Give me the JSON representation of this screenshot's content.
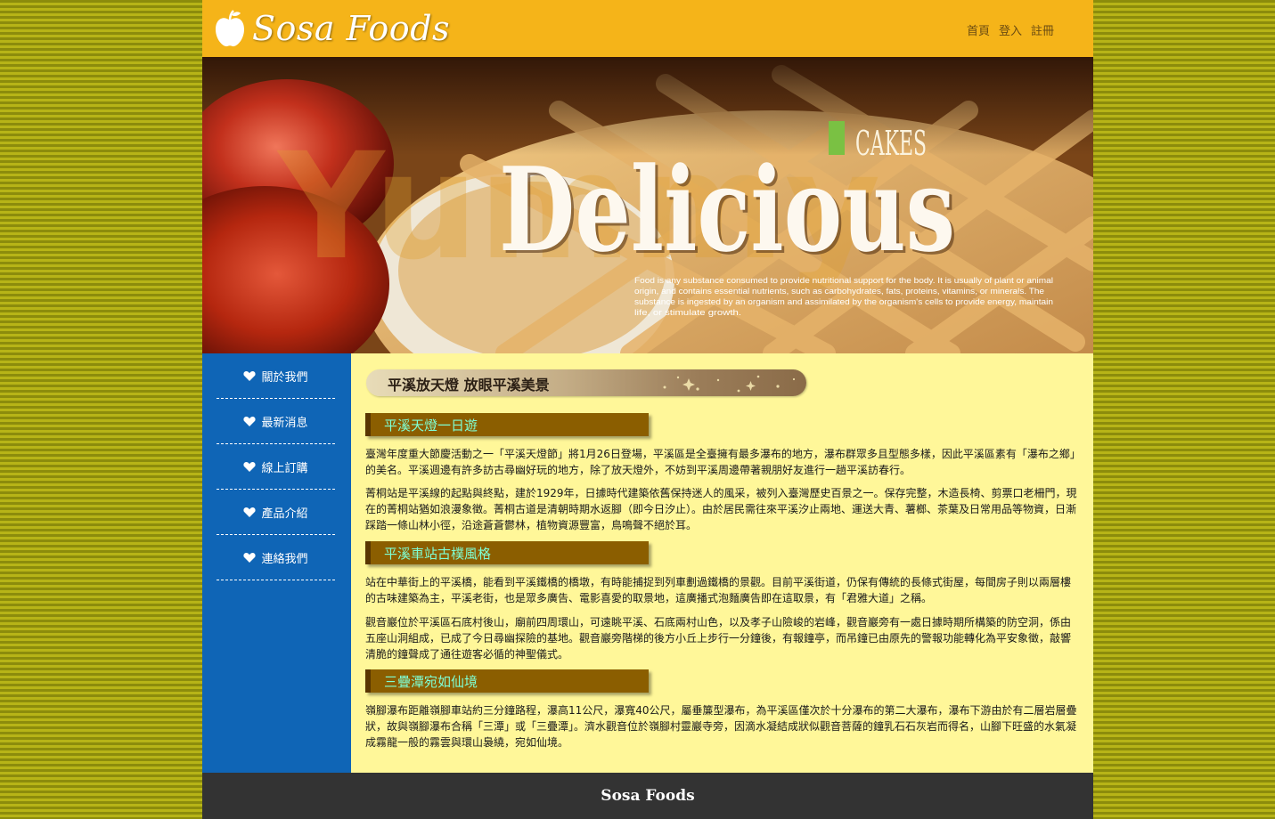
{
  "header": {
    "logo_text": "Sosa Foods",
    "nav": [
      "首頁",
      "登入",
      "註冊"
    ]
  },
  "banner": {
    "watermark": "Yummy",
    "tag": "CAKES",
    "headline": "Delicious",
    "blurb_lines": [
      "Food is any substance consumed to provide nutritional support for the body. It is usually of plant or animal",
      "origin, and contains essential nutrients, such as carbohydrates, fats, proteins, vitamins, or minerals. The",
      "substance is ingested by an organism and assimilated by the organism's cells to provide energy, maintain",
      "life, or stimulate growth."
    ]
  },
  "sidebar": {
    "items": [
      {
        "label": "關於我們",
        "icon": "heart-icon"
      },
      {
        "label": "最新消息",
        "icon": "heart-icon"
      },
      {
        "label": "線上訂購",
        "icon": "heart-icon"
      },
      {
        "label": "產品介紹",
        "icon": "heart-icon"
      },
      {
        "label": "連絡我們",
        "icon": "heart-icon"
      }
    ]
  },
  "main": {
    "page_title": "平溪放天燈 放眼平溪美景",
    "sections": [
      {
        "heading": "平溪天燈一日遊",
        "paragraphs": [
          "臺灣年度重大節慶活動之一「平溪天燈節」將1月26日登場，平溪區是全臺擁有最多瀑布的地方，瀑布群眾多且型態多樣，因此平溪區素有「瀑布之鄉」的美名。平溪週邊有許多訪古尋幽好玩的地方，除了放天燈外，不妨到平溪周邊帶著親朋好友進行一趟平溪訪春行。",
          "菁桐站是平溪線的起點與終點，建於1929年，日據時代建築依舊保持迷人的風采，被列入臺灣歷史百景之一。保存完整，木造長椅、剪票口老柵門，現在的菁桐站猶如浪漫象徵。菁桐古道是清朝時期水返腳（即今日汐止）。由於居民需往來平溪汐止兩地、運送大青、薯榔、茶葉及日常用品等物資，日漸踩踏一條山林小徑，沿途蒼蒼鬱林，植物資源豐富，鳥鳴聲不絕於耳。"
        ]
      },
      {
        "heading": "平溪車站古樸風格",
        "paragraphs": [
          "站在中華街上的平溪橋，能看到平溪鐵橋的橋墩，有時能捕捉到列車劃過鐵橋的景觀。目前平溪街道，仍保有傳統的長條式街屋，每間房子則以兩層樓的古味建築為主，平溪老街，也是眾多廣告、電影喜愛的取景地，這廣播式泡麵廣告即在這取景，有「君雅大道」之稱。",
          "觀音巖位於平溪區石底村後山，廟前四周環山，可遠眺平溪、石底兩村山色，以及孝子山險峻的岩峰，觀音巖旁有一處日據時期所構築的防空洞，係由五座山洞組成，已成了今日尋幽探險的基地。觀音巖旁階梯的後方小丘上步行一分鐘後，有報鐘亭，而吊鐘已由原先的警報功能轉化為平安象徵，敲響清脆的鐘聲成了通往遊客必循的神聖儀式。"
        ]
      },
      {
        "heading": "三疊潭宛如仙境",
        "paragraphs": [
          "嶺腳瀑布距離嶺腳車站約三分鐘路程，瀑高11公尺，瀑寬40公尺，屬垂簾型瀑布，為平溪區僅次於十分瀑布的第二大瀑布，瀑布下游由於有二層岩層疊狀，故與嶺腳瀑布合稱「三潭」或「三疊潭」。濟水觀音位於嶺腳村靈巖寺旁，因滴水凝結成狀似觀音菩薩的鐘乳石石灰岩而得名，山腳下旺盛的水氣凝成霧龍一般的霧雲與環山裊繞，宛如仙境。"
        ]
      }
    ]
  },
  "footer": {
    "text": "Sosa Foods"
  }
}
